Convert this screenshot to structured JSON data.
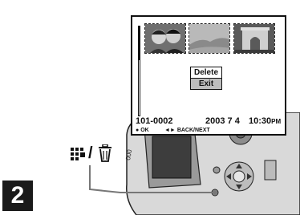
{
  "step": {
    "number": "2"
  },
  "button_label": {
    "text": "/"
  },
  "screen": {
    "menu": {
      "delete_label": "Delete",
      "exit_label": "Exit",
      "selected": "Exit"
    },
    "info": {
      "file_number": "101-0002",
      "date": "2003 7 4",
      "time": "10:30",
      "ampm": "PM"
    },
    "footer": {
      "ok_label": "OK",
      "nav_label": "BACK/NEXT"
    }
  }
}
